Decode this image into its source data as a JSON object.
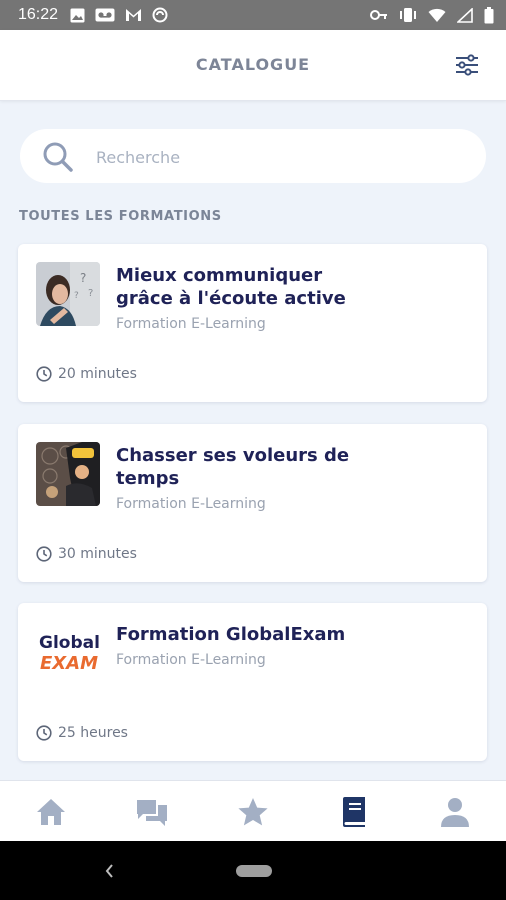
{
  "status_bar": {
    "time": "16:22",
    "left_icons": [
      "image-icon",
      "voicemail-icon",
      "gmail-icon",
      "sync-icon"
    ],
    "right_icons": [
      "vpn-key-icon",
      "vibrate-icon",
      "wifi-icon",
      "signal-icon",
      "battery-icon"
    ]
  },
  "header": {
    "title": "CATALOGUE",
    "filter_icon": "tune-icon"
  },
  "search": {
    "placeholder": "Recherche",
    "value": ""
  },
  "section_title": "TOUTES LES FORMATIONS",
  "courses": [
    {
      "title": "Mieux communiquer grâce à l'écoute active",
      "type": "Formation E-Learning",
      "duration": "20 minutes"
    },
    {
      "title": "Chasser ses voleurs de temps",
      "type": "Formation E-Learning",
      "duration": "30 minutes"
    },
    {
      "title": "Formation GlobalExam",
      "type": "Formation E-Learning",
      "duration": "25 heures",
      "logo_text_top": "Global",
      "logo_text_bottom": "EXAM"
    }
  ],
  "bottom_nav": {
    "items": [
      "home-icon",
      "chat-icon",
      "star-icon",
      "book-icon",
      "person-icon"
    ],
    "active_index": 3,
    "active_color": "#1f3566",
    "inactive_color": "#a3afc4"
  },
  "colors": {
    "accent_dark": "#1f2257",
    "background": "#eef3fa"
  }
}
